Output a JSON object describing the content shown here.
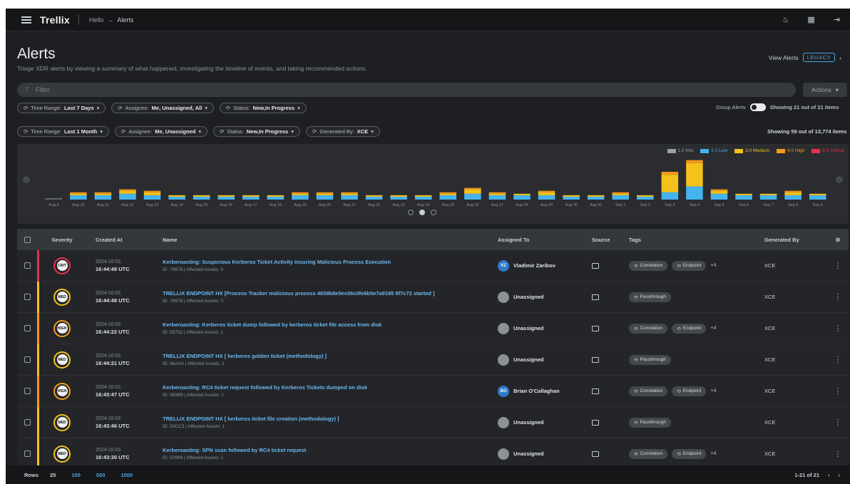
{
  "app": {
    "brand": "Trellix",
    "breadcrumb": [
      "Hello",
      "→",
      "Alerts"
    ]
  },
  "header": {
    "title": "Alerts",
    "subtitle": "Triage XDR alerts by viewing a summary of what happened, investigating the timeline of events, and taking recommended actions.",
    "view_alerts_label": "View Alerts",
    "legacy_badge": "LEGACY"
  },
  "search": {
    "placeholder": "Filter",
    "actions_label": "Actions"
  },
  "filters_row1": [
    {
      "label": "Time Range:",
      "value": "Last 7 Days"
    },
    {
      "label": "Assignee:",
      "value": "Me, Unassigned, All"
    },
    {
      "label": "Status:",
      "value": "New,In Progress"
    }
  ],
  "group_alerts": {
    "label": "Group Alerts",
    "showing": "Showing 21 out of 21 items"
  },
  "filters_row2": [
    {
      "label": "Time Range:",
      "value": "Last 1 Month"
    },
    {
      "label": "Assignee:",
      "value": "Me, Unassigned"
    },
    {
      "label": "Status:",
      "value": "New,In Progress"
    },
    {
      "label": "Generated By:",
      "value": "XCE"
    }
  ],
  "showing2": "Showing 59 out of 13,774 items",
  "legend": [
    {
      "label": "1.0 Info",
      "color": "#9a9ea5"
    },
    {
      "label": "2.0 Low",
      "color": "#45b3f0"
    },
    {
      "label": "3.0 Medium",
      "color": "#f4c21b"
    },
    {
      "label": "4.0 High",
      "color": "#f59a1b"
    },
    {
      "label": "5.0 Critical",
      "color": "#e8314a"
    }
  ],
  "chart_data": {
    "type": "bar",
    "stacked": true,
    "categories": [
      "Aug 9",
      "Aug 10",
      "Aug 11",
      "Aug 12",
      "Aug 13",
      "Aug 14",
      "Aug 15",
      "Aug 16",
      "Aug 17",
      "Aug 18",
      "Aug 19",
      "Aug 20",
      "Aug 21",
      "Aug 22",
      "Aug 23",
      "Aug 24",
      "Aug 25",
      "Aug 26",
      "Aug 27",
      "Aug 28",
      "Aug 29",
      "Aug 30",
      "Aug 31",
      "Sep 1",
      "Sep 2",
      "Sep 3",
      "Sep 4",
      "Sep 5",
      "Sep 6",
      "Sep 7",
      "Sep 8",
      "Sep 9"
    ],
    "series": [
      {
        "name": "1.0 Info",
        "values": [
          0,
          0,
          0,
          0,
          0,
          0,
          0,
          0,
          0,
          0,
          0,
          0,
          0,
          0,
          0,
          0,
          0,
          0,
          0,
          0,
          0,
          0,
          0,
          0,
          0,
          0,
          0,
          0,
          0,
          0,
          0,
          0
        ]
      },
      {
        "name": "2.0 Low",
        "values": [
          0,
          3,
          3,
          4,
          3,
          2,
          2,
          2,
          2,
          2,
          3,
          3,
          3,
          2,
          2,
          2,
          3,
          4,
          3,
          3,
          3,
          2,
          2,
          3,
          2,
          5,
          9,
          4,
          3,
          3,
          3,
          3
        ]
      },
      {
        "name": "3.0 Medium",
        "values": [
          0,
          1,
          1,
          2,
          2,
          1,
          1,
          1,
          1,
          1,
          1,
          1,
          1,
          1,
          1,
          1,
          1,
          3,
          1,
          1,
          2,
          1,
          1,
          1,
          1,
          12,
          16,
          2,
          1,
          1,
          2,
          1
        ]
      },
      {
        "name": "4.0 High",
        "values": [
          0,
          1,
          1,
          1,
          1,
          0,
          0,
          0,
          0,
          0,
          1,
          1,
          1,
          0,
          0,
          0,
          1,
          1,
          1,
          0,
          1,
          0,
          0,
          1,
          0,
          2,
          2,
          1,
          0,
          0,
          1,
          0
        ]
      },
      {
        "name": "5.0 Critical",
        "values": [
          0,
          0,
          0,
          0,
          0,
          0,
          0,
          0,
          0,
          0,
          0,
          0,
          0,
          0,
          0,
          0,
          0,
          0,
          0,
          0,
          0,
          0,
          0,
          0,
          0,
          0,
          0,
          0,
          0,
          0,
          0,
          0
        ]
      }
    ]
  },
  "table": {
    "columns": [
      "Severity",
      "Created At",
      "Name",
      "Assigned To",
      "Source",
      "Tags",
      "Generated By"
    ],
    "rows": [
      {
        "severity": "crit",
        "sev_color": "#e8314a",
        "sev_text": "CRIT",
        "date": "2024-10-01",
        "time": "16:44:48 UTC",
        "name": "Kerberoasting: Suspicious Kerberos Ticket Activity Insuring Malicious Process Execution",
        "meta": "ID: 79676 | Affected Assets: 0",
        "assignee": "Vladimir Zaribov",
        "assignee_initials": "VZ",
        "assignee_blue": true,
        "tags": [
          "Correlation",
          "Endpoint"
        ],
        "more_tags": "+4",
        "generated_by": "XCE"
      },
      {
        "severity": "med",
        "sev_color": "#f4c21b",
        "sev_text": "MED",
        "date": "2024-10-01",
        "time": "16:44:48 UTC",
        "name": "TRELLIX ENDPOINT HX [Process Tracker malicious process 4659b8e5ec06c0fe6b5e7a9195 9f7c72 started ]",
        "meta": "ID: 78676 | Affected Assets: 0",
        "assignee": "Unassigned",
        "assignee_initials": "",
        "assignee_blue": false,
        "tags": [
          "Passthrough"
        ],
        "more_tags": "",
        "generated_by": "XCE"
      },
      {
        "severity": "high",
        "sev_color": "#f59a1b",
        "sev_text": "HIGH",
        "date": "2024-10-01",
        "time": "16:44:22 UTC",
        "name": "Kerberoasting: Kerberos ticket dump followed by kerberos ticket file access from disk",
        "meta": "ID: 59752 | Affected Assets: 1",
        "assignee": "Unassigned",
        "assignee_initials": "",
        "assignee_blue": false,
        "tags": [
          "Correlation",
          "Endpoint"
        ],
        "more_tags": "+4",
        "generated_by": "XCE"
      },
      {
        "severity": "med",
        "sev_color": "#f4c21b",
        "sev_text": "MED",
        "date": "2024-10-01",
        "time": "16:44:21 UTC",
        "name": "TRELLIX ENDPOINT HX [ kerberos golden ticket (methodology) ]",
        "meta": "ID: 68AA3 | Affected Assets: 1",
        "assignee": "Unassigned",
        "assignee_initials": "",
        "assignee_blue": false,
        "tags": [
          "Passthrough"
        ],
        "more_tags": "",
        "generated_by": "XCE"
      },
      {
        "severity": "high",
        "sev_color": "#f59a1b",
        "sev_text": "HIGH",
        "date": "2024-10-01",
        "time": "16:43:47 UTC",
        "name": "Kerberoasting: RC4 ticket request followed by Kerberos Tickets dumped on disk",
        "meta": "ID: 569B9 | Affected Assets: 1",
        "assignee": "Brian O'Callaghan",
        "assignee_initials": "BO",
        "assignee_blue": true,
        "tags": [
          "Correlation",
          "Endpoint"
        ],
        "more_tags": "+4",
        "generated_by": "XCE"
      },
      {
        "severity": "med",
        "sev_color": "#f4c21b",
        "sev_text": "MED",
        "date": "2024-10-01",
        "time": "16:43:46 UTC",
        "name": "TRELLIX ENDPOINT HX [ kerberos ticket file creation (methodology) ]",
        "meta": "ID: 53CC3 | Affected Assets: 1",
        "assignee": "Unassigned",
        "assignee_initials": "",
        "assignee_blue": false,
        "tags": [
          "Passthrough"
        ],
        "more_tags": "",
        "generated_by": "XCE"
      },
      {
        "severity": "med",
        "sev_color": "#f4c21b",
        "sev_text": "MED",
        "date": "2024-10-01",
        "time": "16:43:30 UTC",
        "name": "Kerberoasting: SPN scan followed by RC4 ticket request",
        "meta": "ID: 53999 | Affected Assets: 1",
        "assignee": "Unassigned",
        "assignee_initials": "",
        "assignee_blue": false,
        "tags": [
          "Correlation",
          "Endpoint"
        ],
        "more_tags": "+4",
        "generated_by": "XCE"
      }
    ]
  },
  "footer": {
    "rows_label": "Rows",
    "rows_options": [
      "25",
      "100",
      "500",
      "1000"
    ],
    "page_info": "1-21 of 21"
  }
}
